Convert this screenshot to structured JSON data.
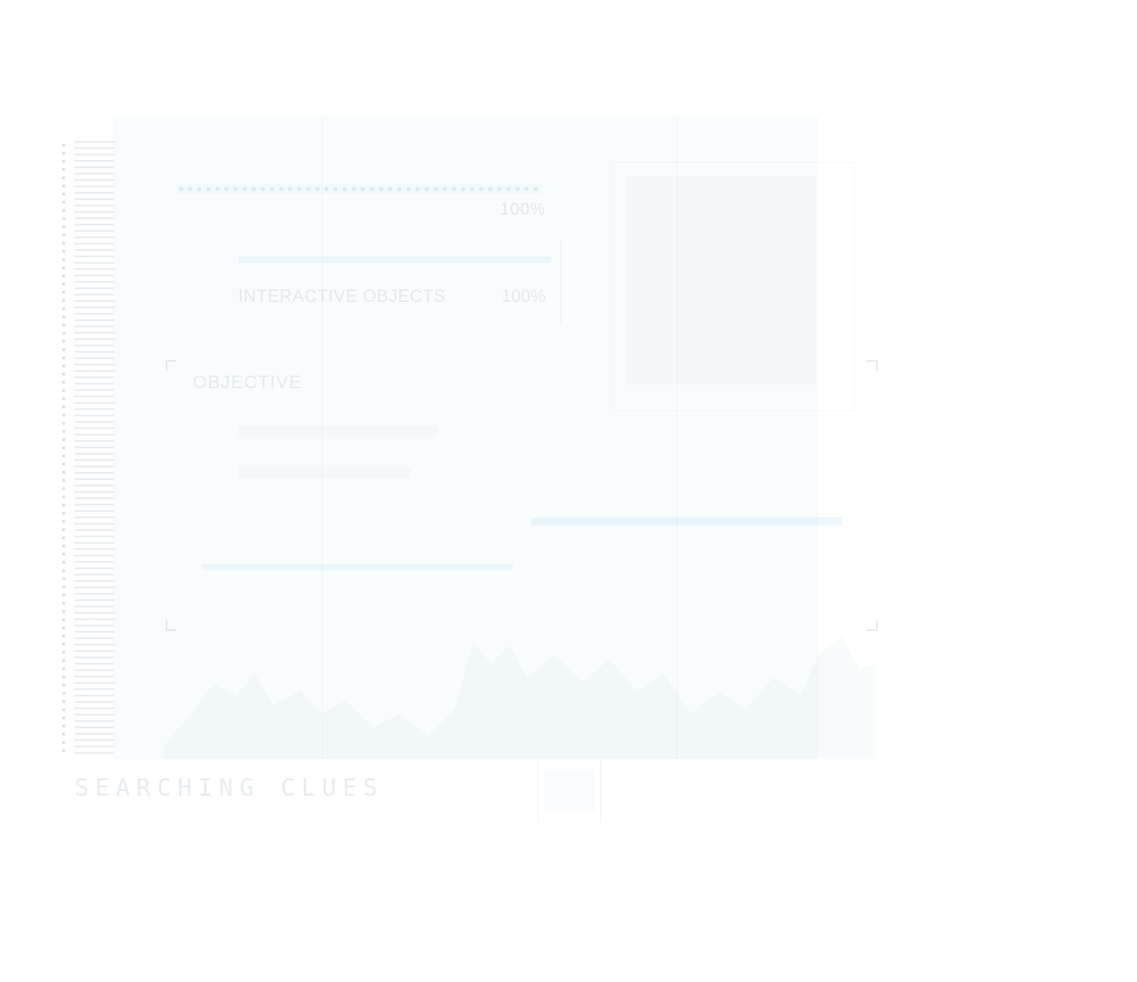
{
  "hud": {
    "progress_top": "100%",
    "row_label": "INTERACTIVE OBJECTS",
    "row_percent": "100%",
    "section_title": "OBJECTIVE",
    "status": "SEARCHING CLUES"
  },
  "colors": {
    "accent": "#8cc8e4",
    "text": "#7896aa",
    "panel": "#eaf3f7"
  },
  "icons": {
    "corner_marker": "corner-bracket"
  }
}
